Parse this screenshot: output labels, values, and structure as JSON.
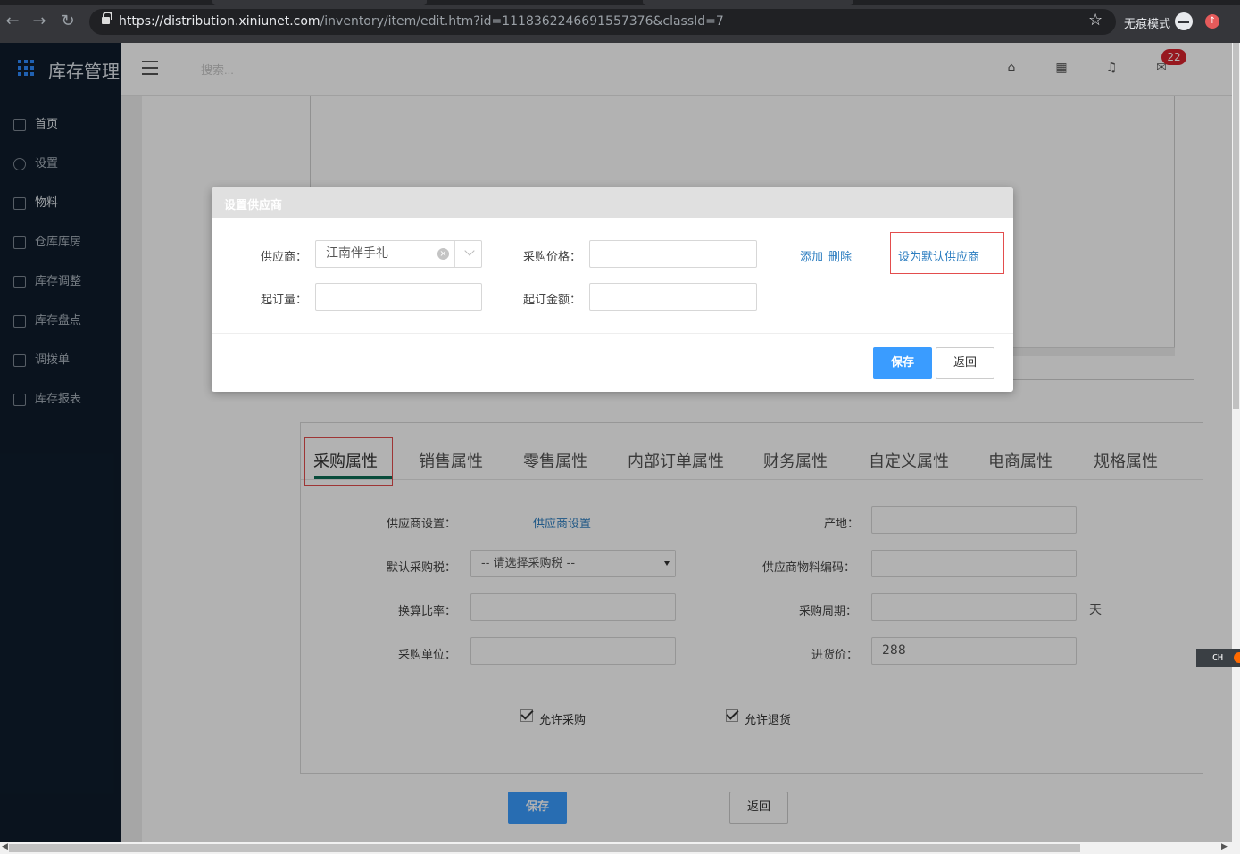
{
  "browser": {
    "url_host": "https://distribution.xiniunet.com",
    "url_path": "/inventory/item/edit.htm?id=1118362246691557376&classId=7",
    "incognito_label": "无痕模式"
  },
  "app": {
    "title": "库存管理",
    "search_placeholder": "搜索...",
    "mail_badge": "22"
  },
  "sidebar": {
    "items": [
      {
        "label": "首页",
        "icon": "home-icon"
      },
      {
        "label": "设置",
        "icon": "gear-icon"
      },
      {
        "label": "物料",
        "icon": "cube-icon"
      },
      {
        "label": "仓库库房",
        "icon": "warehouse-icon"
      },
      {
        "label": "库存调整",
        "icon": "adjust-icon"
      },
      {
        "label": "库存盘点",
        "icon": "stocktake-icon"
      },
      {
        "label": "调拨单",
        "icon": "transfer-icon"
      },
      {
        "label": "库存报表",
        "icon": "bar-chart-icon"
      }
    ]
  },
  "modal": {
    "title": "设置供应商",
    "supplier_label": "供应商：",
    "supplier_value": "江南伴手礼",
    "price_label": "采购价格：",
    "price_value": "",
    "add_link": "添加",
    "delete_link": "删除",
    "set_default_link": "设为默认供应商",
    "min_qty_label": "起订量：",
    "min_qty_value": "",
    "min_amount_label": "起订金额：",
    "min_amount_value": "",
    "save_button": "保存",
    "back_button": "返回"
  },
  "tabs": [
    {
      "label": "采购属性",
      "active": true
    },
    {
      "label": "销售属性"
    },
    {
      "label": "零售属性"
    },
    {
      "label": "内部订单属性"
    },
    {
      "label": "财务属性"
    },
    {
      "label": "自定义属性"
    },
    {
      "label": "电商属性"
    },
    {
      "label": "规格属性"
    }
  ],
  "purchase": {
    "supplier_setting_label": "供应商设置：",
    "supplier_setting_link": "供应商设置",
    "origin_label": "产地：",
    "origin_value": "",
    "default_tax_label": "默认采购税：",
    "default_tax_value": "-- 请选择采购税 --",
    "supplier_code_label": "供应商物料编码：",
    "supplier_code_value": "",
    "conversion_label": "换算比率：",
    "conversion_value": "",
    "cycle_label": "采购周期：",
    "cycle_value": "",
    "cycle_unit": "天",
    "unit_label": "采购单位：",
    "unit_value": "",
    "purchase_price_label": "进货价：",
    "purchase_price_value": "288",
    "allow_purchase": "允许采购",
    "allow_return": "允许退货"
  },
  "page_buttons": {
    "save": "保存",
    "back": "返回"
  },
  "ime_label": "CH"
}
